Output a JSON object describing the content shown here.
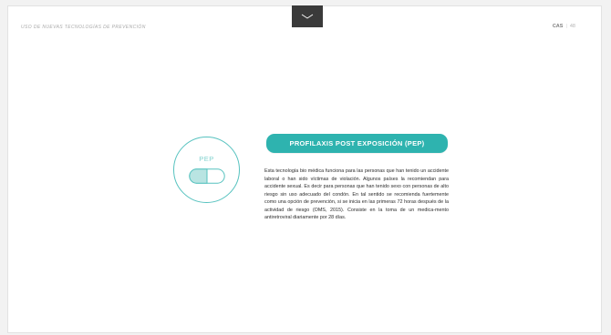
{
  "header": {
    "section_title": "USO DE NUEVAS TECNOLOGÍAS DE PREVENCIÓN",
    "language": "CAS",
    "separator": "|",
    "page_number": "48"
  },
  "nav": {
    "toggle_icon": "chevron-down-icon"
  },
  "pep_badge": {
    "label": "PEP",
    "icon": "pill-icon"
  },
  "content": {
    "title": "PROFILAXIS POST EXPOSICIÓN (PEP)",
    "paragraph": "Esta tecnología bio médica funciona para las personas que han tenido un accidente laboral o han sido víctimas de violación. Algunos países la recomiendan para accidente sexual. Es decir para personas que han tenido sexo con personas de alto riesgo sin uso adecuado del condón. En tal sentido se recomienda fuertemente como una opción de prevención, si se inicia en las primeras 72 horas después de la actividad de riesgo (OMS, 2015). Consiste en la toma de un medica-mento antiretroviral diariamente por 28 días."
  },
  "colors": {
    "accent": "#2eb3af",
    "accent_light": "#7fd1ce",
    "nav_bg": "#3a3a3a",
    "text": "#2c2c2c"
  }
}
